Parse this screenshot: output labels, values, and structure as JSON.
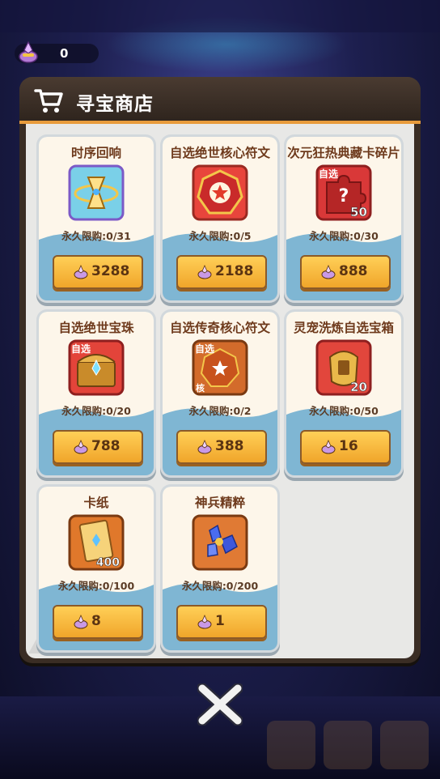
{
  "currency": {
    "value": "0",
    "icon": "crystal-pouch-icon"
  },
  "shop": {
    "title": "寻宝商店",
    "icon": "shopping-cart-icon",
    "items": [
      {
        "name": "时序回响",
        "limit": "永久限购:0/31",
        "price": "3288",
        "icon": "hourglass-icon"
      },
      {
        "name": "自选绝世核心符文",
        "limit": "永久限购:0/5",
        "price": "2188",
        "icon": "red-star-rune-icon"
      },
      {
        "name": "次元狂热典藏卡碎片",
        "limit": "永久限购:0/30",
        "price": "888",
        "icon": "puzzle-piece-icon",
        "tag": "自选",
        "qty": "50"
      },
      {
        "name": "自选绝世宝珠",
        "limit": "永久限购:0/20",
        "price": "788",
        "icon": "treasure-chest-icon",
        "tag": "自选"
      },
      {
        "name": "自选传奇核心符文",
        "limit": "永久限购:0/2",
        "price": "388",
        "icon": "orange-core-rune-icon",
        "tag": "自选",
        "tag2": "核"
      },
      {
        "name": "灵宠洗炼自选宝箱",
        "limit": "永久限购:0/50",
        "price": "16",
        "icon": "golden-armor-chest-icon",
        "qty": "20"
      },
      {
        "name": "卡纸",
        "limit": "永久限购:0/100",
        "price": "8",
        "icon": "card-paper-icon",
        "qty": "400"
      },
      {
        "name": "神兵精粹",
        "limit": "永久限购:0/200",
        "price": "1",
        "icon": "blue-crystal-icon"
      }
    ]
  },
  "colors": {
    "accent": "#e89b3b",
    "card_bg": "#fdf6ea",
    "button": "#f0a52a",
    "text_brown": "#6e3a1c"
  }
}
